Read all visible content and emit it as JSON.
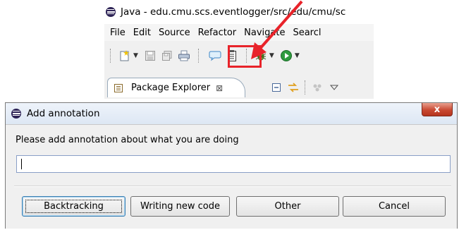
{
  "ide": {
    "window_title": "Java - edu.cmu.scs.eventlogger/src/edu/cmu/sc",
    "menu": [
      "File",
      "Edit",
      "Source",
      "Refactor",
      "Navigate",
      "Searcl"
    ],
    "package_tab": {
      "label": "Package Explorer",
      "close_glyph": "⊠"
    },
    "accent_highlight": "#e8232a"
  },
  "dialog": {
    "title": "Add annotation",
    "close_glyph": "x",
    "prompt": "Please add annotation about what you are doing",
    "input_value": "",
    "buttons": {
      "backtracking": "Backtracking",
      "writing_new_code": "Writing new code",
      "other": "Other",
      "cancel": "Cancel"
    }
  },
  "icons": {
    "app": "eclipse-icon",
    "toolbar": [
      "new-icon",
      "save-icon",
      "save-all-icon",
      "print-icon",
      "annotation-icon",
      "clipboard-icon",
      "debug-icon",
      "run-icon"
    ],
    "tab_tools": [
      "package-icon",
      "collapse-all-icon",
      "link-editor-icon",
      "view-menu-icon"
    ]
  }
}
